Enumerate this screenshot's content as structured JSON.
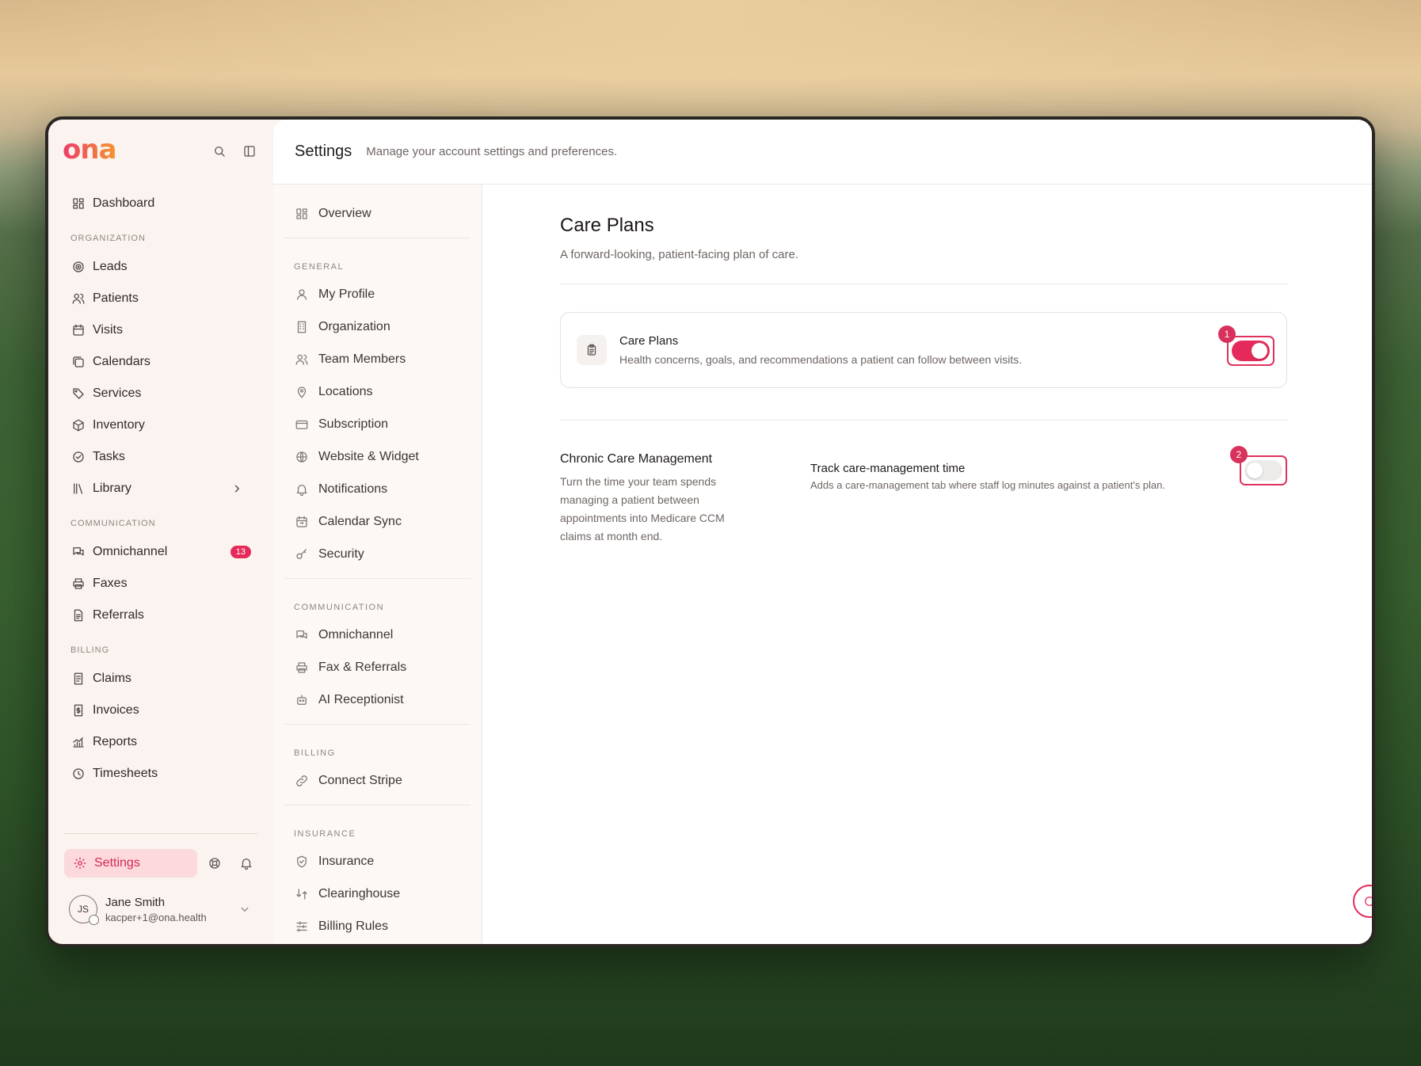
{
  "app": {
    "logo": "ona"
  },
  "sidebar": {
    "dashboard": "Dashboard",
    "sections": [
      {
        "label": "ORGANIZATION",
        "items": [
          {
            "label": "Leads",
            "icon": "target-icon"
          },
          {
            "label": "Patients",
            "icon": "users-icon"
          },
          {
            "label": "Visits",
            "icon": "calendar-icon"
          },
          {
            "label": "Calendars",
            "icon": "calendars-icon"
          },
          {
            "label": "Services",
            "icon": "tag-icon"
          },
          {
            "label": "Inventory",
            "icon": "box-icon"
          },
          {
            "label": "Tasks",
            "icon": "check-circle-icon"
          },
          {
            "label": "Library",
            "icon": "library-icon",
            "chevron": true
          }
        ]
      },
      {
        "label": "COMMUNICATION",
        "items": [
          {
            "label": "Omnichannel",
            "icon": "chat-icon",
            "badge": "13"
          },
          {
            "label": "Faxes",
            "icon": "printer-icon"
          },
          {
            "label": "Referrals",
            "icon": "document-icon"
          }
        ]
      },
      {
        "label": "BILLING",
        "items": [
          {
            "label": "Claims",
            "icon": "receipt-icon"
          },
          {
            "label": "Invoices",
            "icon": "invoice-icon"
          },
          {
            "label": "Reports",
            "icon": "chart-icon"
          },
          {
            "label": "Timesheets",
            "icon": "clock-icon"
          }
        ]
      }
    ],
    "settings_label": "Settings",
    "user": {
      "initials": "JS",
      "name": "Jane Smith",
      "email": "kacper+1@ona.health"
    }
  },
  "header": {
    "title": "Settings",
    "subtitle": "Manage your account settings and preferences."
  },
  "subnav": {
    "overview": "Overview",
    "sections": [
      {
        "label": "GENERAL",
        "items": [
          "My Profile",
          "Organization",
          "Team Members",
          "Locations",
          "Subscription",
          "Website & Widget",
          "Notifications",
          "Calendar Sync",
          "Security"
        ]
      },
      {
        "label": "COMMUNICATION",
        "items": [
          "Omnichannel",
          "Fax & Referrals",
          "AI Receptionist"
        ]
      },
      {
        "label": "BILLING",
        "items": [
          "Connect Stripe"
        ]
      },
      {
        "label": "INSURANCE",
        "items": [
          "Insurance",
          "Clearinghouse",
          "Billing Rules"
        ]
      }
    ]
  },
  "content": {
    "title": "Care Plans",
    "description": "A forward-looking, patient-facing plan of care.",
    "card": {
      "title": "Care Plans",
      "description": "Health concerns, goals, and recommendations a patient can follow between visits.",
      "enabled": true,
      "marker": "1"
    },
    "ccm": {
      "title": "Chronic Care Management",
      "description": "Turn the time your team spends managing a patient between appointments into Medicare CCM claims at month end.",
      "option_title": "Track care-management time",
      "option_desc": "Adds a care-management tab where staff log minutes against a patient's plan.",
      "enabled": false,
      "marker": "2"
    }
  },
  "colors": {
    "accent": "#e52a5b",
    "sidebar_bg": "#fbf3ef"
  }
}
